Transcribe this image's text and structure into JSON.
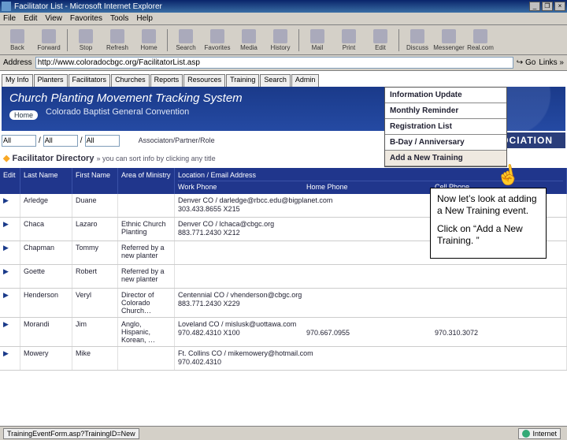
{
  "window": {
    "title": "Facilitator List - Microsoft Internet Explorer"
  },
  "menu": {
    "items": [
      "File",
      "Edit",
      "View",
      "Favorites",
      "Tools",
      "Help"
    ]
  },
  "toolbar": {
    "buttons": [
      "Back",
      "Forward",
      "Stop",
      "Refresh",
      "Home",
      "Search",
      "Favorites",
      "Media",
      "History",
      "Mail",
      "Print",
      "Edit",
      "Discuss",
      "Messenger",
      "Real.com"
    ]
  },
  "address": {
    "label": "Address",
    "value": "http://www.coloradocbgc.org/FacilitatorList.asp",
    "go": "Go",
    "links": "Links »"
  },
  "tabs": [
    "My Info",
    "Planters",
    "Facilitators",
    "Churches",
    "Reports",
    "Resources",
    "Training",
    "Search",
    "Admin"
  ],
  "banner": {
    "title": "Church Planting Movement Tracking System",
    "sub": "Colorado Baptist General Convention",
    "home": "Home"
  },
  "adminMenu": {
    "items": [
      "Information Update",
      "Monthly Reminder",
      "Registration List",
      "B-Day / Anniversary",
      "Add a New Training"
    ]
  },
  "filter": {
    "all": "All",
    "role": "Associaton/Partner/Role",
    "assoc": "ASSOCIATION"
  },
  "dir": {
    "title": "Facilitator Directory",
    "hint": "» you can sort info by clicking any title"
  },
  "head": {
    "edit": "Edit",
    "last": "Last Name",
    "first": "First Name",
    "area": "Area of Ministry",
    "loc": "Location / Email Address",
    "work": "Work Phone",
    "home": "Home Phone",
    "cell": "Cell Phone"
  },
  "rows": [
    {
      "last": "Arledge",
      "first": "Duane",
      "area": "",
      "loc": "Denver CO / darledge@rbcc.edu@bigplanet.com",
      "work": "303.433.8655 X215",
      "home": "",
      "cell": ""
    },
    {
      "last": "Chaca",
      "first": "Lazaro",
      "area": "Ethnic Church Planting",
      "loc": "Denver CO / lchaca@cbgc.org",
      "work": "883.771.2430 X212",
      "home": "",
      "cell": ""
    },
    {
      "last": "Chapman",
      "first": "Tommy",
      "area": "Referred by a new planter",
      "loc": "",
      "work": "",
      "home": "",
      "cell": ""
    },
    {
      "last": "Goette",
      "first": "Robert",
      "area": "Referred by a new planter",
      "loc": "",
      "work": "",
      "home": "",
      "cell": ""
    },
    {
      "last": "Henderson",
      "first": "Veryl",
      "area": "Director of Colorado Church…",
      "loc": "Centennial CO / vhenderson@cbgc.org",
      "work": "883.771.2430 X229",
      "home": "",
      "cell": ""
    },
    {
      "last": "Morandi",
      "first": "Jim",
      "area": "Anglo, Hispanic, Korean, …",
      "loc": "Loveland CO / mislusk@uottawa.com",
      "work": "970.482.4310 X100",
      "home": "970.667.0955",
      "cell": "970.310.3072"
    },
    {
      "last": "Mowery",
      "first": "Mike",
      "area": "",
      "loc": "Ft. Collins CO / mikemowery@hotmail.com",
      "work": "970.402.4310",
      "home": "",
      "cell": ""
    }
  ],
  "callout": {
    "p1": "Now let’s look at adding a New Training event.",
    "p2": "Click on “Add a New Training. ”"
  },
  "status": {
    "left": "TrainingEventForm.asp?TrainingID=New",
    "right": "Internet"
  }
}
